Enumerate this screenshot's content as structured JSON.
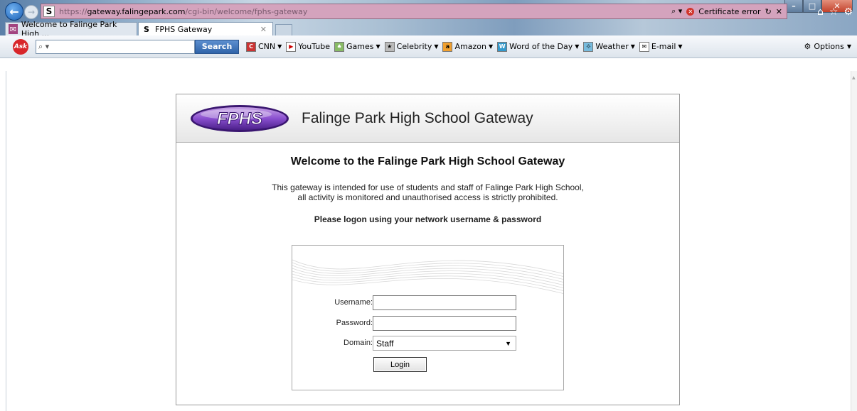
{
  "browser": {
    "address": {
      "scheme": "https://",
      "host": "gateway.falingepark.com",
      "path": "/cgi-bin/welcome/fphs-gateway",
      "certificate_label": "Certificate error"
    },
    "tabs": [
      {
        "label": "Welcome to Falinge Park High ..."
      },
      {
        "label": "FPHS Gateway"
      }
    ],
    "ask_toolbar": {
      "search_label": "Search",
      "bookmarks": [
        {
          "label": "CNN"
        },
        {
          "label": "YouTube"
        },
        {
          "label": "Games"
        },
        {
          "label": "Celebrity"
        },
        {
          "label": "Amazon"
        },
        {
          "label": "Word of the Day"
        },
        {
          "label": "Weather"
        },
        {
          "label": "E-mail"
        }
      ],
      "options_label": "Options"
    }
  },
  "page": {
    "logo_text": "FPHS",
    "header_title": "Falinge Park High School Gateway",
    "welcome": "Welcome to the Falinge Park High School Gateway",
    "notice_line1": "This gateway is intended for use of students and staff of Falinge Park High School,",
    "notice_line2": "all activity is monitored and unauthorised access is strictly prohibited.",
    "logon_prompt": "Please logon using your network username & password",
    "form": {
      "username_label": "Username:",
      "username_value": "",
      "password_label": "Password:",
      "password_value": "",
      "domain_label": "Domain:",
      "domain_value": "Staff",
      "login_label": "Login"
    }
  }
}
